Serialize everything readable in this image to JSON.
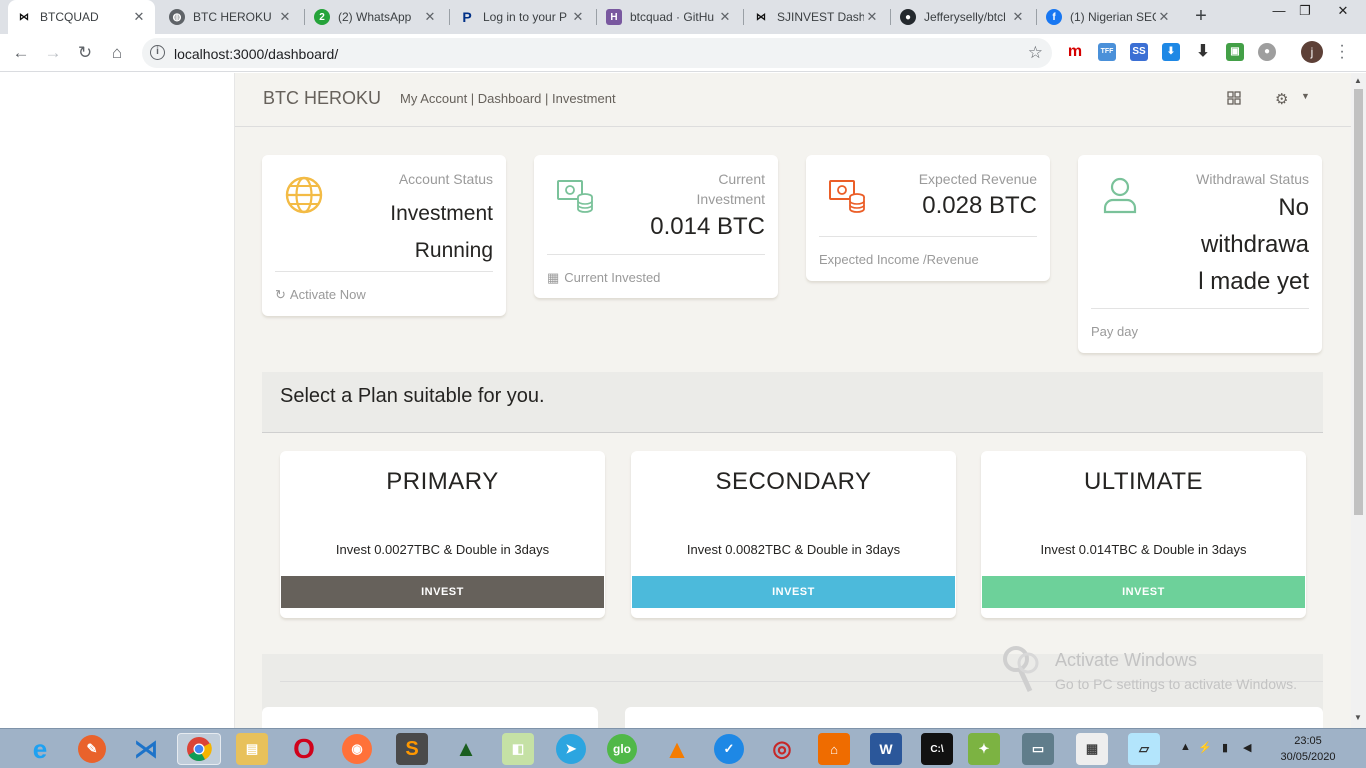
{
  "browser": {
    "tabs": [
      {
        "title": "BTCQUAD",
        "icon": "bowtie-icon",
        "active": true
      },
      {
        "title": "BTC HEROKU",
        "icon": "globe-icon"
      },
      {
        "title": "(2) WhatsApp",
        "icon": "whatsapp-icon",
        "badge": "2"
      },
      {
        "title": "Log in to your P",
        "icon": "paypal-icon"
      },
      {
        "title": "btcquad · GitHu",
        "icon": "heroku-icon"
      },
      {
        "title": "SJINVEST Dashb",
        "icon": "bowtie-icon"
      },
      {
        "title": "Jefferyselly/btcl",
        "icon": "github-icon"
      },
      {
        "title": "(1) Nigerian SEC",
        "icon": "facebook-icon"
      }
    ],
    "new_tab_label": "+",
    "url": "localhost:3000/dashboard/",
    "profile_initial": "j"
  },
  "topnav": {
    "brand": "BTC HEROKU",
    "breadcrumb": "My Account | Dashboard | Investment"
  },
  "stats": [
    {
      "category": "Account Status",
      "value_lines": [
        "Investment",
        "Running"
      ],
      "footer": "Activate Now",
      "icon": "globe-icon",
      "footer_icon": "refresh-icon",
      "color": "#f3bb45"
    },
    {
      "category_lines": [
        "Current",
        "Investment"
      ],
      "value": "0.014 BTC",
      "footer": "Current Invested",
      "icon": "money-icon",
      "footer_icon": "calendar-icon",
      "color": "#7ac29a"
    },
    {
      "category": "Expected Revenue",
      "value": "0.028 BTC",
      "footer": "Expected Income /Revenue",
      "icon": "money-icon",
      "color": "#eb5e28"
    },
    {
      "category": "Withdrawal Status",
      "value_lines": [
        "No",
        "withdrawa",
        "l made yet"
      ],
      "footer": "Pay day",
      "icon": "user-icon",
      "color": "#7ac29a"
    }
  ],
  "plans_header": "Select a Plan suitable for you.",
  "plans": [
    {
      "name": "PRIMARY",
      "desc": "Invest 0.0027TBC & Double in 3days",
      "button": "INVEST",
      "color": "#66615b"
    },
    {
      "name": "SECONDARY",
      "desc": "Invest 0.0082TBC & Double in 3days",
      "button": "INVEST",
      "color": "#4cbadb"
    },
    {
      "name": "ULTIMATE",
      "desc": "Invest 0.014TBC & Double in 3days",
      "button": "INVEST",
      "color": "#6dd19a"
    }
  ],
  "watermark": {
    "line1": "Activate Windows",
    "line2": "Go to PC settings to activate Windows."
  },
  "taskbar": {
    "time": "23:05",
    "date": "30/05/2020",
    "apps": [
      "ie-icon",
      "tool-icon",
      "vscode-icon",
      "chrome-icon",
      "file-explorer-icon",
      "opera-icon",
      "firefox-icon",
      "sublime-icon",
      "rocket-icon",
      "folder-icon",
      "telegram-icon",
      "glo-icon",
      "vlc-icon",
      "check-icon",
      "cd-icon",
      "network-icon",
      "word-icon",
      "terminal-icon",
      "paint-icon",
      "computer-icon",
      "calculator-icon",
      "notepad-icon"
    ],
    "glo_label": "glo"
  }
}
